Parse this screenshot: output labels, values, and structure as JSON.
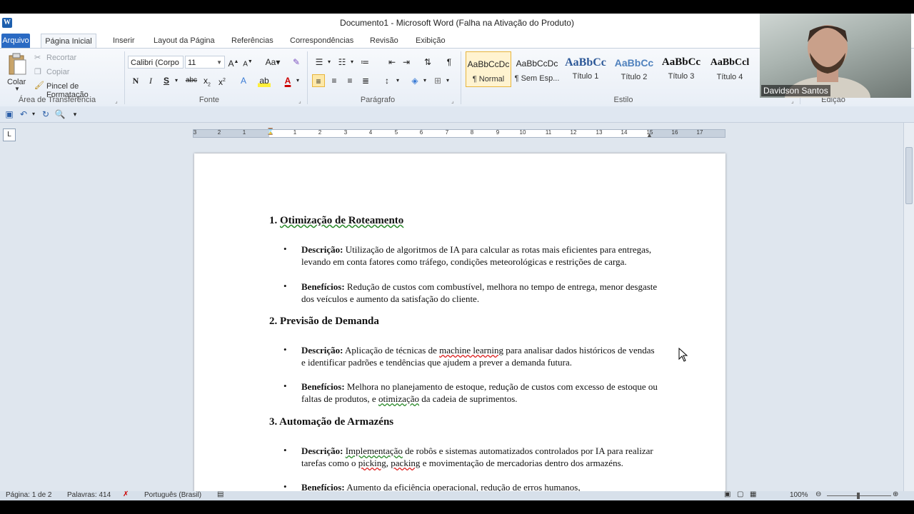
{
  "window": {
    "title": "Documento1 - Microsoft Word (Falha na Ativação do Produto)"
  },
  "tabs": [
    "Arquivo",
    "Página Inicial",
    "Inserir",
    "Layout da Página",
    "Referências",
    "Correspondências",
    "Revisão",
    "Exibição"
  ],
  "clipboard": {
    "paste": "Colar",
    "cut": "Recortar",
    "copy": "Copiar",
    "format_painter": "Pincel de Formatação",
    "label": "Área de Transferência"
  },
  "font": {
    "name": "Calibri (Corpo",
    "size": "11",
    "label": "Fonte"
  },
  "paragraph": {
    "label": "Parágrafo"
  },
  "styles": {
    "label": "Estilo",
    "items": [
      {
        "preview": "AaBbCcDc",
        "name": "¶ Normal"
      },
      {
        "preview": "AaBbCcDc",
        "name": "¶ Sem Esp..."
      },
      {
        "preview": "AaBbCc",
        "name": "Título 1"
      },
      {
        "preview": "AaBbCc",
        "name": "Título 2"
      },
      {
        "preview": "AaBbCc",
        "name": "Título 3"
      },
      {
        "preview": "AaBbCcl",
        "name": "Título 4"
      }
    ]
  },
  "editing": {
    "label": "Edição"
  },
  "webcam": {
    "name": "Davidson Santos"
  },
  "ruler": {
    "numbers": [
      "3",
      "2",
      "1",
      "1",
      "2",
      "3",
      "4",
      "5",
      "6",
      "7",
      "8",
      "9",
      "10",
      "11",
      "12",
      "13",
      "14",
      "15",
      "16",
      "17"
    ]
  },
  "document": {
    "sections": [
      {
        "heading": "1. Otimização de Roteamento",
        "bullets": [
          {
            "label": "Descrição:",
            "text": "Utilização de algoritmos de IA para calcular as rotas mais eficientes para entregas, levando em conta fatores como tráfego, condições meteorológicas e restrições de carga."
          },
          {
            "label": "Benefícios:",
            "text": "Redução de custos com combustível, melhora no tempo de entrega, menor desgaste dos veículos e aumento da satisfação do cliente."
          }
        ]
      },
      {
        "heading": "2. Previsão de Demanda",
        "bullets": [
          {
            "label": "Descrição:",
            "text_a": "Aplicação de técnicas de ",
            "underlined": "machine learning",
            "text_b": " para analisar dados históricos de vendas e identificar padrões e tendências que ajudem a prever a demanda futura."
          },
          {
            "label": "Benefícios:",
            "text_a": "Melhora no planejamento de estoque, redução de custos com excesso de estoque ou faltas de produtos, e ",
            "underlined": "otimização",
            "text_b": " da cadeia de suprimentos."
          }
        ]
      },
      {
        "heading": "3. Automação de Armazéns",
        "bullets": [
          {
            "label": "Descrição:",
            "u1": "Implementação",
            "t1": " de robôs e sistemas automatizados controlados por IA para realizar tarefas como o ",
            "u2": "picking",
            "t2": ", ",
            "u3": "packing",
            "t3": " e movimentação de mercadorias dentro dos armazéns."
          },
          {
            "label": "Benefícios:",
            "text": "Aumento da eficiência operacional, redução de erros humanos,"
          }
        ]
      }
    ]
  },
  "status": {
    "page": "Página: 1 de 2",
    "words": "Palavras: 414",
    "language": "Português (Brasil)",
    "zoom": "100%"
  }
}
